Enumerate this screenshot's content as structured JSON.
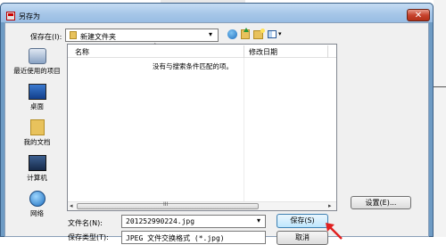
{
  "window": {
    "title": "另存为",
    "close_glyph": "✕"
  },
  "save_in": {
    "label": "保存在(I):",
    "value": "新建文件夹",
    "arrow": "▾"
  },
  "toolbar": {
    "view_arrow": "▾"
  },
  "places": [
    {
      "label": "最近使用的项目",
      "icon": "recent-items-icon"
    },
    {
      "label": "桌面",
      "icon": "desktop-icon"
    },
    {
      "label": "我的文档",
      "icon": "documents-icon"
    },
    {
      "label": "计算机",
      "icon": "computer-icon"
    },
    {
      "label": "网络",
      "icon": "network-icon"
    }
  ],
  "file_list": {
    "columns": [
      "名称",
      "修改日期"
    ],
    "sort_glyph": "˄",
    "empty_message": "没有与搜索条件匹配的项。",
    "scroll_left": "◂",
    "scroll_right": "▸",
    "scroll_grip": "III"
  },
  "file_name": {
    "label": "文件名(N):",
    "value": "201252990224.jpg",
    "arrow": "▾"
  },
  "file_type": {
    "label": "保存类型(T):",
    "value": "JPEG 文件交换格式 (*.jpg)"
  },
  "buttons": {
    "save": "保存(S)",
    "cancel": "取消",
    "settings": "设置(E)..."
  },
  "colors": {
    "title_bar": "#a6c6e8",
    "close_button": "#c6432d",
    "annotation_arrow": "#e02020"
  }
}
